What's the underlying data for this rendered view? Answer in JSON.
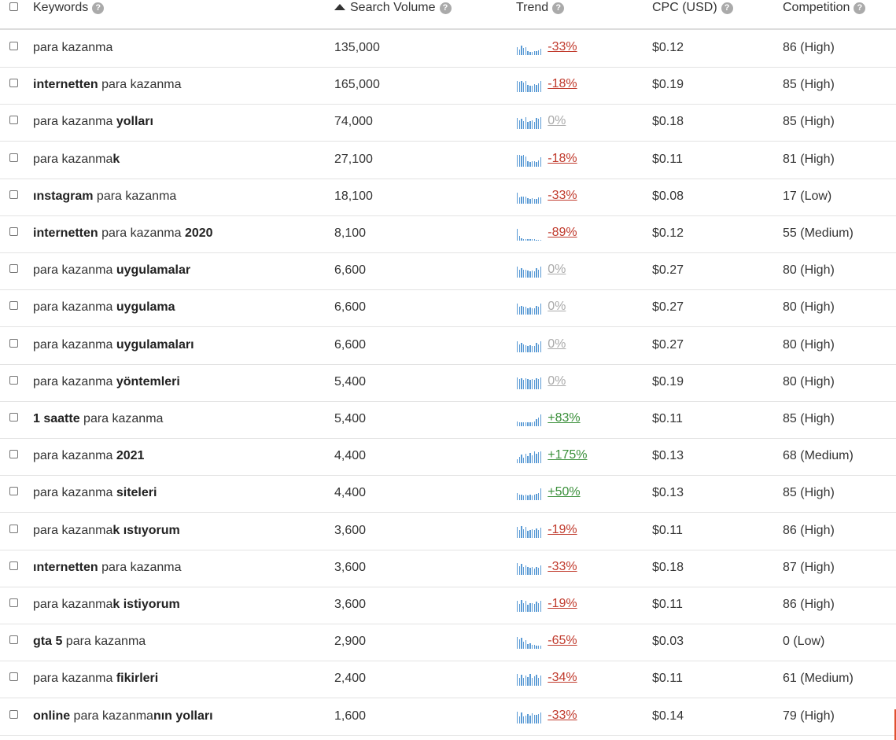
{
  "header": {
    "keywords": "Keywords",
    "search_volume": "Search Volume",
    "trend": "Trend",
    "cpc": "CPC (USD)",
    "competition": "Competition",
    "help_icon": "?"
  },
  "rows": [
    {
      "kw": [
        [
          "para kazanma",
          0
        ]
      ],
      "volume": "135,000",
      "trend": "-33%",
      "dir": "neg",
      "spark": [
        10,
        7,
        12,
        9,
        10,
        5,
        4,
        4,
        5,
        5,
        6,
        8
      ],
      "cpc": "$0.12",
      "comp": "86 (High)"
    },
    {
      "kw": [
        [
          "internetten",
          1
        ],
        [
          " para kazanma",
          0
        ]
      ],
      "volume": "165,000",
      "trend": "-18%",
      "dir": "neg",
      "spark": [
        14,
        13,
        14,
        12,
        14,
        9,
        8,
        8,
        10,
        9,
        11,
        14
      ],
      "cpc": "$0.19",
      "comp": "85 (High)"
    },
    {
      "kw": [
        [
          "para kazanma ",
          0
        ],
        [
          "yolları",
          1
        ]
      ],
      "volume": "74,000",
      "trend": "0%",
      "dir": "zero",
      "spark": [
        14,
        11,
        13,
        10,
        15,
        9,
        10,
        11,
        9,
        14,
        13,
        15
      ],
      "cpc": "$0.18",
      "comp": "85 (High)"
    },
    {
      "kw": [
        [
          "para kazanma",
          0
        ],
        [
          "k",
          1
        ]
      ],
      "volume": "27,100",
      "trend": "-18%",
      "dir": "neg",
      "spark": [
        15,
        15,
        14,
        15,
        13,
        7,
        6,
        7,
        7,
        6,
        8,
        12
      ],
      "cpc": "$0.11",
      "comp": "81 (High)"
    },
    {
      "kw": [
        [
          "ınstagram",
          1
        ],
        [
          " para kazanma",
          0
        ]
      ],
      "volume": "18,100",
      "trend": "-33%",
      "dir": "neg",
      "spark": [
        14,
        8,
        9,
        9,
        9,
        7,
        6,
        7,
        6,
        6,
        8,
        8
      ],
      "cpc": "$0.08",
      "comp": "17 (Low)"
    },
    {
      "kw": [
        [
          "internetten",
          1
        ],
        [
          " para kazanma ",
          0
        ],
        [
          "2020",
          1
        ]
      ],
      "volume": "8,100",
      "trend": "-89%",
      "dir": "neg",
      "spark": [
        15,
        6,
        3,
        2,
        2,
        2,
        2,
        2,
        2,
        1,
        1,
        1
      ],
      "cpc": "$0.12",
      "comp": "55 (Medium)"
    },
    {
      "kw": [
        [
          "para kazanma ",
          0
        ],
        [
          "uygulamalar",
          1
        ]
      ],
      "volume": "6,600",
      "trend": "0%",
      "dir": "zero",
      "spark": [
        14,
        10,
        12,
        10,
        10,
        9,
        8,
        9,
        8,
        12,
        10,
        14
      ],
      "cpc": "$0.27",
      "comp": "80 (High)"
    },
    {
      "kw": [
        [
          "para kazanma ",
          0
        ],
        [
          "uygulama",
          1
        ]
      ],
      "volume": "6,600",
      "trend": "0%",
      "dir": "zero",
      "spark": [
        14,
        10,
        11,
        10,
        10,
        8,
        9,
        8,
        8,
        11,
        10,
        14
      ],
      "cpc": "$0.27",
      "comp": "80 (High)"
    },
    {
      "kw": [
        [
          "para kazanma ",
          0
        ],
        [
          "uygulamaları",
          1
        ]
      ],
      "volume": "6,600",
      "trend": "0%",
      "dir": "zero",
      "spark": [
        14,
        10,
        12,
        10,
        9,
        8,
        9,
        8,
        8,
        12,
        10,
        14
      ],
      "cpc": "$0.27",
      "comp": "80 (High)"
    },
    {
      "kw": [
        [
          "para kazanma ",
          0
        ],
        [
          "yöntemleri",
          1
        ]
      ],
      "volume": "5,400",
      "trend": "0%",
      "dir": "zero",
      "spark": [
        15,
        13,
        14,
        12,
        14,
        13,
        12,
        13,
        12,
        14,
        13,
        15
      ],
      "cpc": "$0.19",
      "comp": "80 (High)"
    },
    {
      "kw": [
        [
          "1 saatte",
          1
        ],
        [
          " para kazanma",
          0
        ]
      ],
      "volume": "5,400",
      "trend": "+83%",
      "dir": "pos",
      "spark": [
        6,
        5,
        5,
        5,
        5,
        5,
        5,
        5,
        6,
        9,
        11,
        15
      ],
      "cpc": "$0.11",
      "comp": "85 (High)"
    },
    {
      "kw": [
        [
          "para kazanma ",
          0
        ],
        [
          "2021",
          1
        ]
      ],
      "volume": "4,400",
      "trend": "+175%",
      "dir": "pos",
      "spark": [
        5,
        8,
        11,
        7,
        12,
        9,
        13,
        10,
        15,
        12,
        14,
        15
      ],
      "cpc": "$0.13",
      "comp": "68 (Medium)"
    },
    {
      "kw": [
        [
          "para kazanma ",
          0
        ],
        [
          "siteleri",
          1
        ]
      ],
      "volume": "4,400",
      "trend": "+50%",
      "dir": "pos",
      "spark": [
        9,
        7,
        7,
        6,
        7,
        6,
        7,
        6,
        7,
        8,
        9,
        15
      ],
      "cpc": "$0.13",
      "comp": "85 (High)"
    },
    {
      "kw": [
        [
          "para kazanma",
          0
        ],
        [
          "k ıstıyorum",
          1
        ]
      ],
      "volume": "3,600",
      "trend": "-19%",
      "dir": "neg",
      "spark": [
        14,
        10,
        15,
        11,
        14,
        9,
        10,
        11,
        10,
        12,
        10,
        13
      ],
      "cpc": "$0.11",
      "comp": "86 (High)"
    },
    {
      "kw": [
        [
          "ınternetten",
          1
        ],
        [
          " para kazanma",
          0
        ]
      ],
      "volume": "3,600",
      "trend": "-33%",
      "dir": "neg",
      "spark": [
        15,
        11,
        14,
        10,
        12,
        10,
        9,
        10,
        8,
        10,
        9,
        12
      ],
      "cpc": "$0.18",
      "comp": "87 (High)"
    },
    {
      "kw": [
        [
          "para kazanma",
          0
        ],
        [
          "k istiyorum",
          1
        ]
      ],
      "volume": "3,600",
      "trend": "-19%",
      "dir": "neg",
      "spark": [
        14,
        10,
        15,
        11,
        14,
        9,
        11,
        11,
        10,
        13,
        11,
        14
      ],
      "cpc": "$0.11",
      "comp": "86 (High)"
    },
    {
      "kw": [
        [
          "gta 5",
          1
        ],
        [
          " para kazanma",
          0
        ]
      ],
      "volume": "2,900",
      "trend": "-65%",
      "dir": "neg",
      "spark": [
        15,
        12,
        14,
        9,
        11,
        6,
        7,
        5,
        5,
        4,
        4,
        4
      ],
      "cpc": "$0.03",
      "comp": "0 (Low)"
    },
    {
      "kw": [
        [
          "para kazanma ",
          0
        ],
        [
          "fikirleri",
          1
        ]
      ],
      "volume": "2,400",
      "trend": "-34%",
      "dir": "neg",
      "spark": [
        15,
        10,
        14,
        10,
        13,
        11,
        15,
        10,
        12,
        14,
        10,
        13
      ],
      "cpc": "$0.11",
      "comp": "61 (Medium)"
    },
    {
      "kw": [
        [
          "online",
          1
        ],
        [
          " para kazanma",
          0
        ],
        [
          "nın yolları",
          1
        ]
      ],
      "volume": "1,600",
      "trend": "-33%",
      "dir": "neg",
      "spark": [
        15,
        9,
        14,
        9,
        10,
        12,
        10,
        13,
        11,
        11,
        12,
        14
      ],
      "cpc": "$0.14",
      "comp": "79 (High)"
    }
  ]
}
